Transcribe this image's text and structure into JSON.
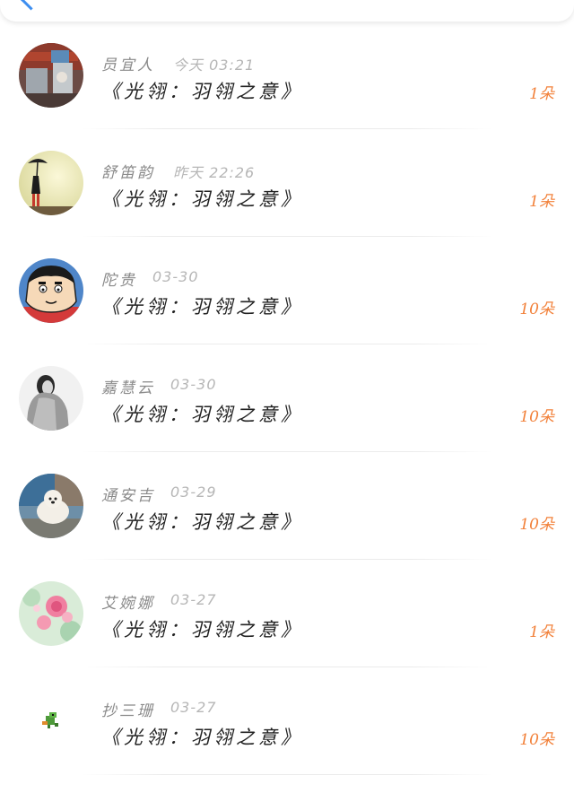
{
  "header": {
    "title": ""
  },
  "colors": {
    "amount": "#f2813a",
    "back": "#3d8ef0"
  },
  "items": [
    {
      "name": "员宜人",
      "time": "今天 03:21",
      "title": "《光翎：羽翎之意》",
      "amount": "1朵",
      "avatar": "avatar-photo-red-room"
    },
    {
      "name": "舒笛韵",
      "time": "昨天 22:26",
      "title": "《光翎：羽翎之意》",
      "amount": "1朵",
      "avatar": "avatar-girl-umbrella"
    },
    {
      "name": "陀贵",
      "time": "03-30",
      "title": "《光翎：羽翎之意》",
      "amount": "10朵",
      "avatar": "avatar-cartoon-boy"
    },
    {
      "name": "嘉慧云",
      "time": "03-30",
      "title": "《光翎：羽翎之意》",
      "amount": "10朵",
      "avatar": "avatar-girl-bw"
    },
    {
      "name": "通安吉",
      "time": "03-29",
      "title": "《光翎：羽翎之意》",
      "amount": "10朵",
      "avatar": "avatar-white-dog"
    },
    {
      "name": "艾婉娜",
      "time": "03-27",
      "title": "《光翎：羽翎之意》",
      "amount": "1朵",
      "avatar": "avatar-pink-flowers"
    },
    {
      "name": "抄三珊",
      "time": "03-27",
      "title": "《光翎：羽翎之意》",
      "amount": "10朵",
      "avatar": "avatar-green-dino"
    }
  ]
}
